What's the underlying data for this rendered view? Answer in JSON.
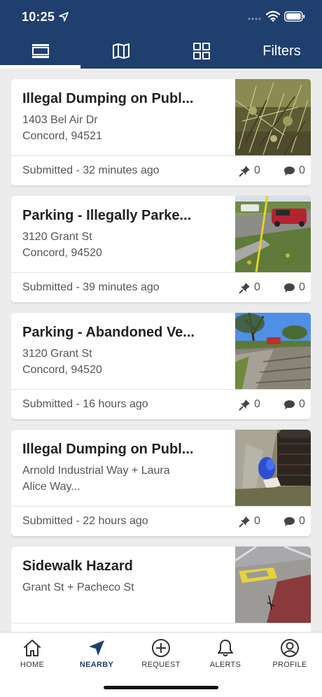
{
  "status_bar": {
    "time": "10:25",
    "icons": [
      "location-arrow-icon",
      "signal-dots-icon",
      "wifi-icon",
      "battery-icon"
    ]
  },
  "tabs": {
    "items": [
      {
        "icon": "list-view-icon",
        "active": true
      },
      {
        "icon": "map-view-icon",
        "active": false
      },
      {
        "icon": "grid-view-icon",
        "active": false
      }
    ],
    "filters_label": "Filters"
  },
  "feed": {
    "cards": [
      {
        "title": "Illegal Dumping on Publ...",
        "address_line1": "1403   Bel Air Dr",
        "address_line2": "Concord,  94521",
        "submitted": "Submitted - 32 minutes ago",
        "pins": "0",
        "comments": "0"
      },
      {
        "title": "Parking - Illegally Parke...",
        "address_line1": "3120   Grant St",
        "address_line2": "Concord,  94520",
        "submitted": "Submitted - 39 minutes ago",
        "pins": "0",
        "comments": "0"
      },
      {
        "title": "Parking - Abandoned Ve...",
        "address_line1": "3120   Grant St",
        "address_line2": "Concord,  94520",
        "submitted": "Submitted - 16 hours ago",
        "pins": "0",
        "comments": "0"
      },
      {
        "title": "Illegal Dumping on Publ...",
        "address_line1": "Arnold Industrial Way + Laura",
        "address_line2": "Alice Way...",
        "submitted": "Submitted - 22 hours ago",
        "pins": "0",
        "comments": "0"
      },
      {
        "title": "Sidewalk Hazard",
        "address_line1": "Grant St + Pacheco St",
        "address_line2": "",
        "submitted": "",
        "pins": "",
        "comments": ""
      }
    ]
  },
  "bottom_nav": {
    "items": [
      {
        "label": "HOME",
        "icon": "home-icon",
        "active": false
      },
      {
        "label": "NEARBY",
        "icon": "nearby-arrow-icon",
        "active": true
      },
      {
        "label": "REQUEST",
        "icon": "plus-circle-icon",
        "active": false
      },
      {
        "label": "ALERTS",
        "icon": "bell-icon",
        "active": false
      },
      {
        "label": "PROFILE",
        "icon": "user-circle-icon",
        "active": false
      }
    ]
  },
  "colors": {
    "header_bg": "#1f3f6e",
    "accent": "#1f3f6e",
    "page_bg": "#ececec",
    "card_bg": "#ffffff"
  }
}
